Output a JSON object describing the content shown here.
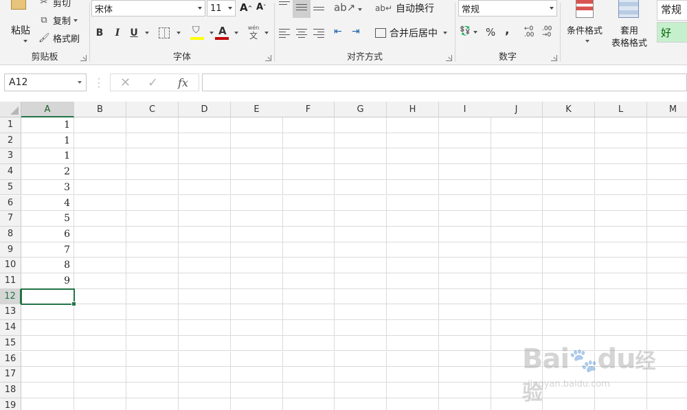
{
  "ribbon": {
    "clipboard": {
      "paste_label": "粘贴",
      "cut_label": "剪切",
      "copy_label": "复制",
      "format_painter_label": "格式刷",
      "group_label": "剪贴板"
    },
    "font": {
      "font_name": "宋体",
      "font_size": "11",
      "bold": "B",
      "italic": "I",
      "underline": "U",
      "phonetic": "wén",
      "phonetic_sub": "文",
      "group_label": "字体"
    },
    "alignment": {
      "wrap_text_label": "自动换行",
      "merge_center_label": "合并后居中",
      "group_label": "对齐方式"
    },
    "number": {
      "format_value": "常规",
      "percent": "%",
      "comma": ",",
      "group_label": "数字"
    },
    "styles": {
      "conditional_format_label": "条件格式",
      "table_format_label_1": "套用",
      "table_format_label_2": "表格格式",
      "style_normal": "常规",
      "style_good": "好"
    }
  },
  "formula_bar": {
    "name_box": "A12",
    "fx": "fx",
    "formula": ""
  },
  "grid": {
    "columns": [
      "A",
      "B",
      "C",
      "D",
      "E",
      "F",
      "G",
      "H",
      "I",
      "J",
      "K",
      "L",
      "M"
    ],
    "rows": [
      "1",
      "2",
      "3",
      "4",
      "5",
      "6",
      "7",
      "8",
      "9",
      "10",
      "11",
      "12",
      "13",
      "14",
      "15",
      "16",
      "17",
      "18",
      "19"
    ],
    "column_a_values": [
      "1",
      "1",
      "1",
      "2",
      "3",
      "4",
      "5",
      "6",
      "7",
      "8",
      "9"
    ],
    "active_cell": "A12"
  },
  "watermark": {
    "brand": "Bai",
    "brand_suffix": "du",
    "product": "经验",
    "url": "jingyan.baidu.com"
  },
  "colors": {
    "excel_green": "#217346",
    "font_color_red": "#c00000",
    "highlight_yellow": "#ffff00",
    "good_style_bg": "#c6efce",
    "good_style_text": "#006100"
  }
}
